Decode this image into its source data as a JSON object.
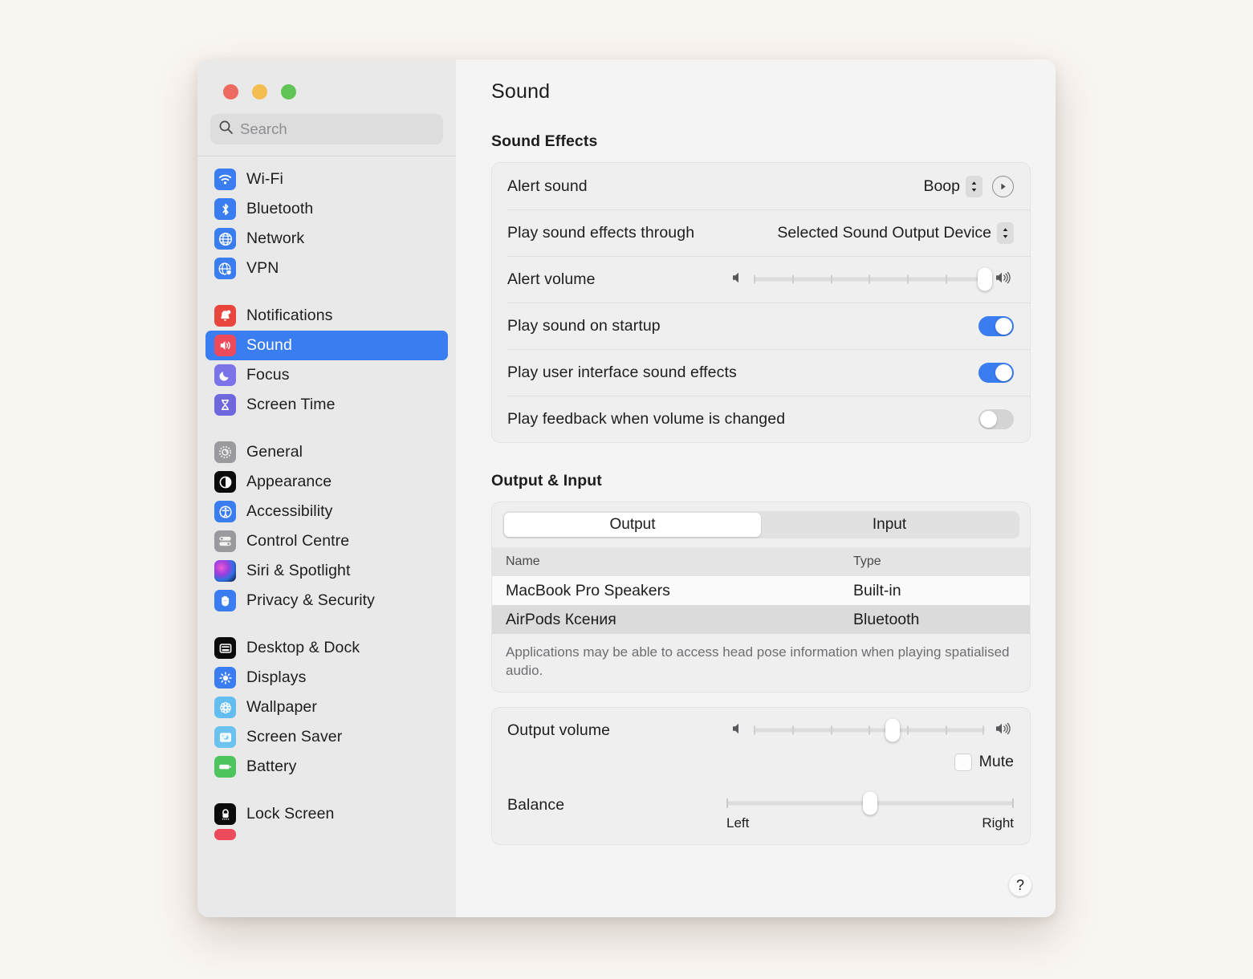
{
  "window": {
    "traffic_lights": [
      "close",
      "minimise",
      "zoom"
    ],
    "colors": {
      "accent": "#3a7df0",
      "sidebar_bg": "#e9e9e9",
      "content_bg": "#f5f4f4",
      "desktop_bg": "#f9f5f1"
    }
  },
  "search": {
    "placeholder": "Search",
    "value": ""
  },
  "sidebar": {
    "groups": [
      {
        "items": [
          {
            "label": "Wi-Fi",
            "icon": "wifi-icon",
            "selected": false
          },
          {
            "label": "Bluetooth",
            "icon": "bluetooth-icon",
            "selected": false
          },
          {
            "label": "Network",
            "icon": "globe-icon",
            "selected": false
          },
          {
            "label": "VPN",
            "icon": "globe-shield-icon",
            "selected": false
          }
        ]
      },
      {
        "items": [
          {
            "label": "Notifications",
            "icon": "bell-icon",
            "selected": false
          },
          {
            "label": "Sound",
            "icon": "speaker-icon",
            "selected": true
          },
          {
            "label": "Focus",
            "icon": "moon-icon",
            "selected": false
          },
          {
            "label": "Screen Time",
            "icon": "hourglass-icon",
            "selected": false
          }
        ]
      },
      {
        "items": [
          {
            "label": "General",
            "icon": "gear-icon",
            "selected": false
          },
          {
            "label": "Appearance",
            "icon": "appearance-icon",
            "selected": false
          },
          {
            "label": "Accessibility",
            "icon": "accessibility-icon",
            "selected": false
          },
          {
            "label": "Control Centre",
            "icon": "control-centre-icon",
            "selected": false
          },
          {
            "label": "Siri & Spotlight",
            "icon": "siri-icon",
            "selected": false
          },
          {
            "label": "Privacy & Security",
            "icon": "hand-icon",
            "selected": false
          }
        ]
      },
      {
        "items": [
          {
            "label": "Desktop & Dock",
            "icon": "desktop-dock-icon",
            "selected": false
          },
          {
            "label": "Displays",
            "icon": "brightness-icon",
            "selected": false
          },
          {
            "label": "Wallpaper",
            "icon": "wallpaper-icon",
            "selected": false
          },
          {
            "label": "Screen Saver",
            "icon": "screen-saver-icon",
            "selected": false
          },
          {
            "label": "Battery",
            "icon": "battery-icon",
            "selected": false
          }
        ]
      },
      {
        "items": [
          {
            "label": "Lock Screen",
            "icon": "lock-screen-icon",
            "selected": false
          }
        ]
      }
    ]
  },
  "main": {
    "title": "Sound",
    "sound_effects": {
      "heading": "Sound Effects",
      "alert_sound": {
        "label": "Alert sound",
        "value": "Boop"
      },
      "play_through": {
        "label": "Play sound effects through",
        "value": "Selected Sound Output Device"
      },
      "alert_volume": {
        "label": "Alert volume",
        "percent": 100,
        "ticks": 7
      },
      "toggles": [
        {
          "label": "Play sound on startup",
          "on": true
        },
        {
          "label": "Play user interface sound effects",
          "on": true
        },
        {
          "label": "Play feedback when volume is changed",
          "on": false
        }
      ]
    },
    "output_input": {
      "heading": "Output & Input",
      "tabs": [
        {
          "label": "Output",
          "active": true
        },
        {
          "label": "Input",
          "active": false
        }
      ],
      "columns": [
        "Name",
        "Type"
      ],
      "devices": [
        {
          "name": "MacBook Pro Speakers",
          "type": "Built-in",
          "selected": false
        },
        {
          "name": "AirPods Ксения",
          "type": "Bluetooth",
          "selected": true
        }
      ],
      "note": "Applications may be able to access head pose information when playing spatialised audio."
    },
    "output_controls": {
      "output_volume": {
        "label": "Output volume",
        "percent": 60,
        "ticks": 7
      },
      "mute": {
        "label": "Mute",
        "checked": false
      },
      "balance": {
        "label": "Balance",
        "percent": 50,
        "left_label": "Left",
        "right_label": "Right"
      }
    },
    "help": {
      "label": "?"
    }
  }
}
